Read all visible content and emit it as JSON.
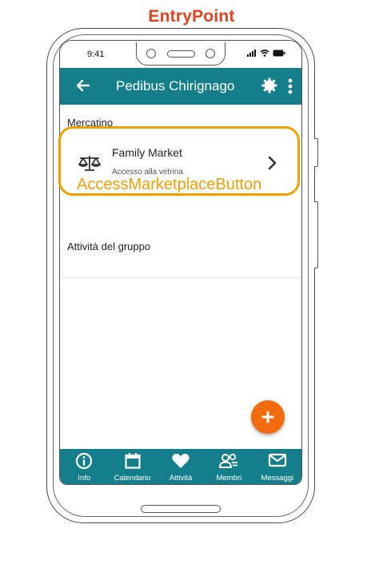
{
  "annotation": {
    "entry_title": "EntryPoint",
    "highlight_label": "AccessMarketplaceButton",
    "highlight_color": "#f5a000",
    "title_color": "#e8401c"
  },
  "status_bar": {
    "time": "9:41"
  },
  "app_bar": {
    "title": "Pedibus Chirignago",
    "back_icon": "arrow-left-icon",
    "settings_icon": "gear-icon",
    "menu_icon": "more-vertical-icon",
    "color": "#147f8a"
  },
  "content": {
    "section_label": "Mercatino",
    "market": {
      "name": "Family Market",
      "subtitle": "Accesso alla vetrina",
      "icon": "scale-icon",
      "chevron": "chevron-right-icon"
    },
    "activity_label": "Attività del gruppo"
  },
  "fab": {
    "icon": "plus-icon",
    "color": "#f26b0f"
  },
  "bottom_nav": {
    "items": [
      {
        "label": "Info",
        "icon": "info-icon"
      },
      {
        "label": "Calendario",
        "icon": "calendar-icon"
      },
      {
        "label": "Attività",
        "icon": "heart-icon"
      },
      {
        "label": "Membri",
        "icon": "members-icon"
      },
      {
        "label": "Messaggi",
        "icon": "mail-icon"
      }
    ]
  }
}
